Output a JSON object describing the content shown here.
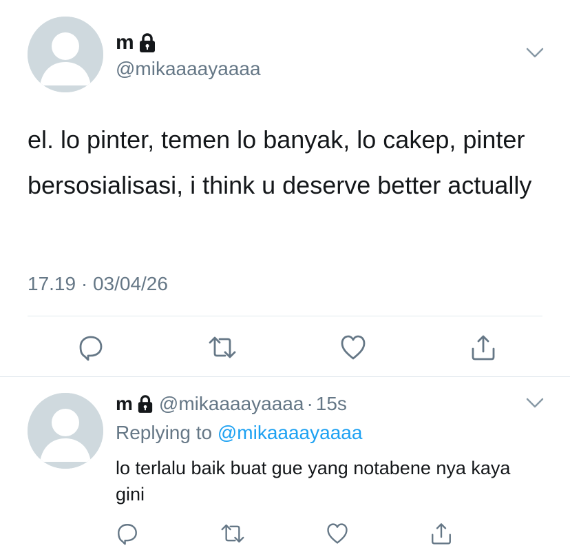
{
  "main_tweet": {
    "display_name": "m",
    "handle": "@mikaaaayaaaa",
    "text": "el. lo pinter, temen lo banyak, lo cakep, pinter bersosialisasi, i think u deserve better actually",
    "timestamp": "17.19 · 03/04/26",
    "icons": [
      "lock-icon",
      "chevron-down-icon",
      "reply-icon",
      "retweet-icon",
      "like-icon",
      "share-icon"
    ]
  },
  "reply_tweet": {
    "display_name": "m",
    "handle": "@mikaaaayaaaa",
    "time_sep": "·",
    "time": "15s",
    "replying_prefix": "Replying to",
    "replying_to": "@mikaaaayaaaa",
    "text": "lo terlalu baik buat gue yang notabene nya kaya gini",
    "icons": [
      "lock-icon",
      "chevron-down-icon",
      "reply-icon",
      "retweet-icon",
      "like-icon",
      "share-icon"
    ]
  },
  "colors": {
    "text": "#14171a",
    "secondary": "#657786",
    "link": "#1da1f2",
    "divider": "#e1e8ed",
    "avatar_bg": "#cfd9de"
  }
}
